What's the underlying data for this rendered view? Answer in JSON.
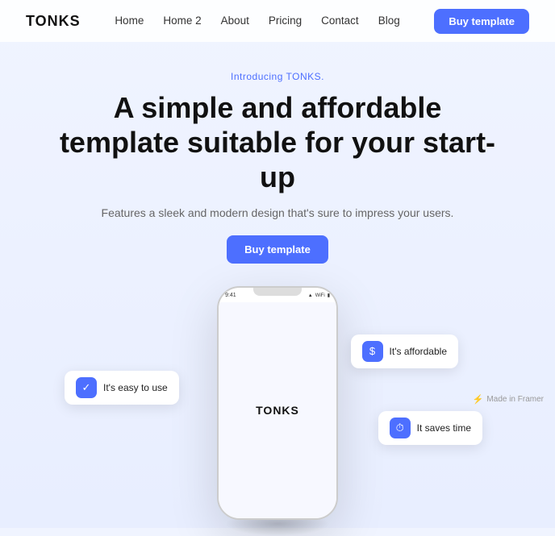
{
  "navbar": {
    "logo": "TONKS",
    "links": [
      {
        "label": "Home",
        "href": "#"
      },
      {
        "label": "Home 2",
        "href": "#"
      },
      {
        "label": "About",
        "href": "#"
      },
      {
        "label": "Pricing",
        "href": "#"
      },
      {
        "label": "Contact",
        "href": "#"
      },
      {
        "label": "Blog",
        "href": "#"
      }
    ],
    "cta_label": "Buy template"
  },
  "hero": {
    "intro": "Introducing TONKS.",
    "title": "A simple and affordable template suitable for your start-up",
    "subtitle": "Features a sleek and modern design that's sure to impress your users.",
    "cta_label": "Buy template"
  },
  "phone": {
    "status_time": "9:41",
    "brand": "TONKS"
  },
  "badges": [
    {
      "id": "affordable",
      "icon": "$",
      "label": "It's affordable"
    },
    {
      "id": "easy",
      "icon": "✓",
      "label": "It's easy to use"
    },
    {
      "id": "time",
      "icon": "⏱",
      "label": "It saves time"
    }
  ],
  "framer": {
    "label": "Made in Framer"
  }
}
